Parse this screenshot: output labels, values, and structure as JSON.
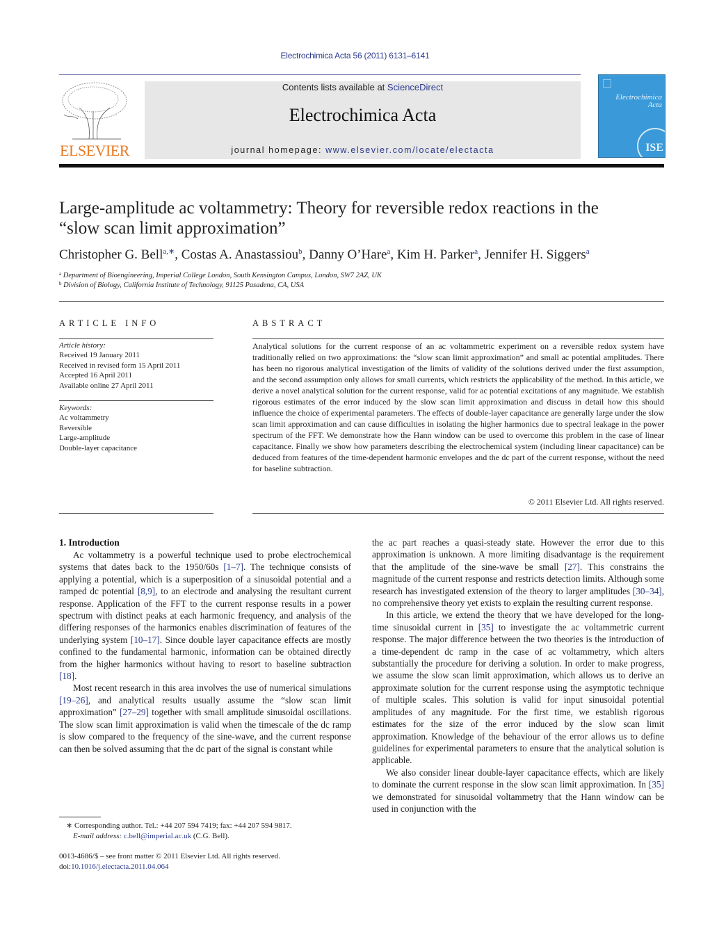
{
  "header": {
    "journal_ref": "Electrochimica Acta 56 (2011) 6131–6141",
    "contents_prefix": "Contents lists available at ",
    "contents_link": "ScienceDirect",
    "journal_title": "Electrochimica Acta",
    "homepage_prefix": "journal homepage: ",
    "homepage_link": "www.elsevier.com/locate/electacta",
    "publisher_logo_text": "ELSEVIER",
    "cover_title_line1": "Electrochimica",
    "cover_title_line2": "Acta",
    "cover_seal_text": "ISE",
    "colors": {
      "link": "#2c3a8c",
      "elsevier_orange": "#e97a22",
      "cover_blue": "#3a9ad9",
      "masthead_gray": "#e7e7e7"
    }
  },
  "article": {
    "title_line1": "Large-amplitude ac voltammetry: Theory for reversible redox reactions in the",
    "title_line2": "“slow scan limit approximation”",
    "authors": [
      {
        "name": "Christopher G. Bell",
        "sup": "a,∗"
      },
      {
        "name": "Costas A. Anastassiou",
        "sup": "b"
      },
      {
        "name": "Danny O’Hare",
        "sup": "a"
      },
      {
        "name": "Kim H. Parker",
        "sup": "a"
      },
      {
        "name": "Jennifer H. Siggers",
        "sup": "a"
      }
    ],
    "affiliations": [
      {
        "mark": "a",
        "text": "Department of Bioengineering, Imperial College London, South Kensington Campus, London, SW7 2AZ, UK"
      },
      {
        "mark": "b",
        "text": "Division of Biology, California Institute of Technology, 91125 Pasadena, CA, USA"
      }
    ]
  },
  "article_info": {
    "heading": "ARTICLE INFO",
    "history_label": "Article history:",
    "history": [
      "Received 19 January 2011",
      "Received in revised form 15 April 2011",
      "Accepted 16 April 2011",
      "Available online 27 April 2011"
    ],
    "keywords_label": "Keywords:",
    "keywords": [
      "Ac voltammetry",
      "Reversible",
      "Large-amplitude",
      "Double-layer capacitance"
    ]
  },
  "abstract": {
    "heading": "ABSTRACT",
    "text": "Analytical solutions for the current response of an ac voltammetric experiment on a reversible redox system have traditionally relied on two approximations: the “slow scan limit approximation” and small ac potential amplitudes. There has been no rigorous analytical investigation of the limits of validity of the solutions derived under the first assumption, and the second assumption only allows for small currents, which restricts the applicability of the method. In this article, we derive a novel analytical solution for the current response, valid for ac potential excitations of any magnitude. We establish rigorous estimates of the error induced by the slow scan limit approximation and discuss in detail how this should influence the choice of experimental parameters. The effects of double-layer capacitance are generally large under the slow scan limit approximation and can cause difficulties in isolating the higher harmonics due to spectral leakage in the power spectrum of the FFT. We demonstrate how the Hann window can be used to overcome this problem in the case of linear capacitance. Finally we show how parameters describing the electrochemical system (including linear capacitance) can be deduced from features of the time-dependent harmonic envelopes and the dc part of the current response, without the need for baseline subtraction.",
    "copyright": "© 2011 Elsevier Ltd. All rights reserved."
  },
  "body": {
    "section_heading": "1.  Introduction",
    "left_paragraphs": [
      [
        {
          "t": "Ac voltammetry is a powerful technique used to probe electrochemical systems that dates back to the 1950/60s "
        },
        {
          "ref": "[1–7]"
        },
        {
          "t": ". The technique consists of applying a potential, which is a superposition of a sinusoidal potential and a ramped dc potential "
        },
        {
          "ref": "[8,9]"
        },
        {
          "t": ", to an electrode and analysing the resultant current response. Application of the FFT to the current response results in a power spectrum with distinct peaks at each harmonic frequency, and analysis of the differing responses of the harmonics enables discrimination of features of the underlying system "
        },
        {
          "ref": "[10–17]"
        },
        {
          "t": ". Since double layer capacitance effects are mostly confined to the fundamental harmonic, information can be obtained directly from the higher harmonics without having to resort to baseline subtraction "
        },
        {
          "ref": "[18]"
        },
        {
          "t": "."
        }
      ],
      [
        {
          "t": "Most recent research in this area involves the use of numerical simulations "
        },
        {
          "ref": "[19–26]"
        },
        {
          "t": ", and analytical results usually assume the “slow scan limit approximation” "
        },
        {
          "ref": "[27–29]"
        },
        {
          "t": " together with small amplitude sinusoidal oscillations. The slow scan limit approximation is valid when the timescale of the dc ramp is slow compared to the frequency of the sine-wave, and the current response can then be solved assuming that the dc part of the signal is constant while"
        }
      ]
    ],
    "right_paragraphs": [
      [
        {
          "t": "the ac part reaches a quasi-steady state. However the error due to this approximation is unknown. A more limiting disadvantage is the requirement that the amplitude of the sine-wave be small "
        },
        {
          "ref": "[27]"
        },
        {
          "t": ". This constrains the magnitude of the current response and restricts detection limits. Although some research has investigated extension of the theory to larger amplitudes "
        },
        {
          "ref": "[30–34]"
        },
        {
          "t": ", no comprehensive theory yet exists to explain the resulting current response."
        }
      ],
      [
        {
          "t": "In this article, we extend the theory that we have developed for the long-time sinusoidal current in "
        },
        {
          "ref": "[35]"
        },
        {
          "t": " to investigate the ac voltammetric current response. The major difference between the two theories is the introduction of a time-dependent dc ramp in the case of ac voltammetry, which alters substantially the procedure for deriving a solution. In order to make progress, we assume the slow scan limit approximation, which allows us to derive an approximate solution for the current response using the asymptotic technique of multiple scales. This solution is valid for input sinusoidal potential amplitudes of any magnitude. For the first time, we establish rigorous estimates for the size of the error induced by the slow scan limit approximation. Knowledge of the behaviour of the error allows us to define guidelines for experimental parameters to ensure that the analytical solution is applicable."
        }
      ],
      [
        {
          "t": "We also consider linear double-layer capacitance effects, which are likely to dominate the current response in the slow scan limit approximation. In "
        },
        {
          "ref": "[35]"
        },
        {
          "t": " we demonstrated for sinusoidal voltammetry that the Hann window can be used in conjunction with the"
        }
      ]
    ]
  },
  "footer": {
    "footnote_mark": "∗",
    "footnote_text": "Corresponding author. Tel.: +44 207 594 7419; fax: +44 207 594 9817.",
    "email_label": "E-mail address:",
    "email": "c.bell@imperial.ac.uk",
    "email_suffix": " (C.G. Bell).",
    "issn_line": "0013-4686/$ – see front matter © 2011 Elsevier Ltd. All rights reserved.",
    "doi_prefix": "doi:",
    "doi": "10.1016/j.electacta.2011.04.064"
  }
}
